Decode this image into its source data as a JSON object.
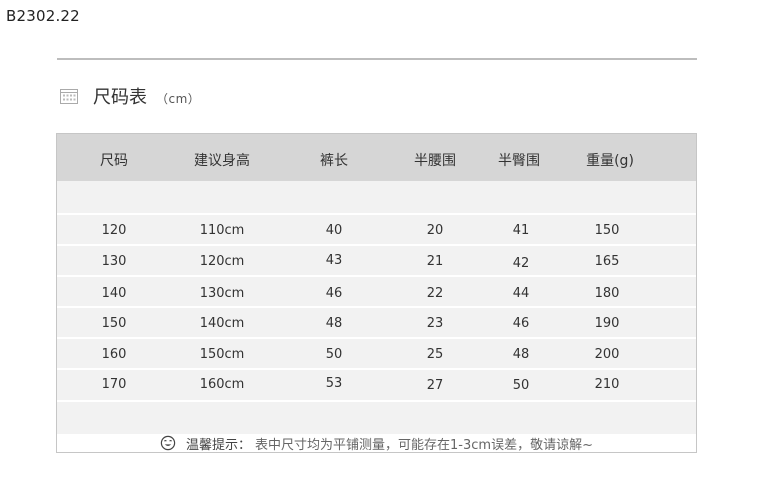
{
  "code": "B2302.22",
  "title": "尺码表",
  "unit": "（cm）",
  "icons": {
    "title": "calendar-grid-icon",
    "note": "smiley-face-icon"
  },
  "table": {
    "headers": [
      "尺码",
      "建议身高",
      "裤长",
      "半腰围",
      "半臀围",
      "重量(g)"
    ],
    "rows": [
      [
        "120",
        "110cm",
        "40",
        "20",
        "41",
        "150"
      ],
      [
        "130",
        "120cm",
        "43",
        "21",
        "42",
        "165"
      ],
      [
        "140",
        "130cm",
        "46",
        "22",
        "44",
        "180"
      ],
      [
        "150",
        "140cm",
        "48",
        "23",
        "46",
        "190"
      ],
      [
        "160",
        "150cm",
        "50",
        "25",
        "48",
        "200"
      ],
      [
        "170",
        "160cm",
        "53",
        "27",
        "50",
        "210"
      ]
    ]
  },
  "note": {
    "label": "温馨提示：",
    "text": "表中尺寸均为平铺测量，可能存在1-3cm误差，敬请谅解~"
  }
}
